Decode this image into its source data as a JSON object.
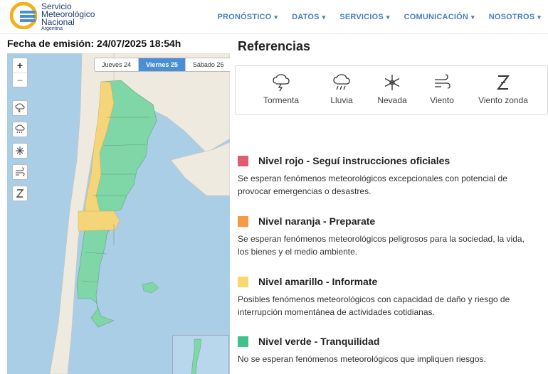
{
  "brand": {
    "line1": "Servicio",
    "line2": "Meteorológico",
    "line3": "Nacional",
    "line4": "Argentina"
  },
  "nav": [
    {
      "label": "PRONÓSTICO"
    },
    {
      "label": "DATOS"
    },
    {
      "label": "SERVICIOS"
    },
    {
      "label": "COMUNICACIÓN"
    },
    {
      "label": "NOSOTROS"
    }
  ],
  "emission": "Fecha de emisión: 24/07/2025 18:54h",
  "map": {
    "zoom_in": "+",
    "zoom_out": "−",
    "days": [
      {
        "label": "Jueves 24",
        "active": false
      },
      {
        "label": "Viernes 25",
        "active": true
      },
      {
        "label": "Sábado 26",
        "active": false
      }
    ],
    "filter_icons": [
      "tormenta-icon",
      "lluvia-icon",
      "nevada-icon",
      "viento-icon",
      "viento-zonda-icon"
    ]
  },
  "references": {
    "title": "Referencias",
    "items": [
      {
        "label": "Tormenta",
        "icon": "storm-icon"
      },
      {
        "label": "Lluvia",
        "icon": "rain-icon"
      },
      {
        "label": "Nevada",
        "icon": "snow-icon"
      },
      {
        "label": "Viento",
        "icon": "wind-icon"
      },
      {
        "label": "Viento zonda",
        "icon": "zonda-icon"
      }
    ]
  },
  "levels": [
    {
      "color": "#e05d6f",
      "title": "Nivel rojo - Seguí instrucciones oficiales",
      "desc": "Se esperan fenómenos meteorológicos excepcionales con potencial de provocar emergencias o desastres."
    },
    {
      "color": "#f49a47",
      "title": "Nivel naranja - Preparate",
      "desc": "Se esperan fenómenos meteorológicos peligrosos para la sociedad, la vida, los bienes y el medio ambiente."
    },
    {
      "color": "#fbd86b",
      "title": "Nivel amarillo - Informate",
      "desc": "Posibles fenómenos meteorológicos con capacidad de daño y riesgo de interrupción momentánea de actividades cotidianas."
    },
    {
      "color": "#3fc38a",
      "title": "Nivel verde - Tranquilidad",
      "desc": "No se esperan fenómenos meteorológicos que impliquen riesgos."
    }
  ],
  "colors": {
    "accent": "#4a7fc0",
    "map_water": "#a9cee6",
    "map_land": "#eeeae0",
    "green": "#7fd6a6",
    "yellow": "#f5d57a"
  }
}
